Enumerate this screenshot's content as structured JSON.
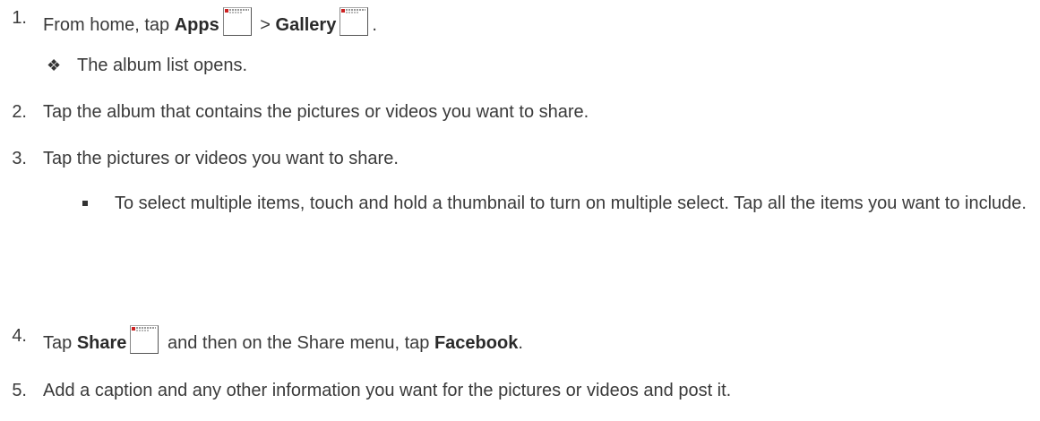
{
  "steps": [
    {
      "number": "1.",
      "pre": "From home, tap ",
      "bold1": "Apps",
      "mid": " > ",
      "bold2": "Gallery",
      "post": ".",
      "icon1": "apps-icon",
      "icon2": "gallery-icon"
    },
    {
      "number": "2.",
      "text": "Tap the album that contains the pictures or videos you want to share."
    },
    {
      "number": "3.",
      "text": "Tap the pictures or videos you want to share."
    },
    {
      "number": "4.",
      "pre": "Tap ",
      "bold1": "Share",
      "mid": " and then on the Share menu, tap ",
      "bold2": "Facebook",
      "post": ".",
      "icon1": "share-icon"
    },
    {
      "number": "5.",
      "text": "Add a caption and any other information you want for the pictures or videos and post it."
    }
  ],
  "result_note": {
    "bullet": "❖",
    "text": "The album list opens."
  },
  "tip": {
    "text": "To select multiple items, touch and hold a thumbnail to turn on multiple select. Tap all the items you want to include."
  }
}
